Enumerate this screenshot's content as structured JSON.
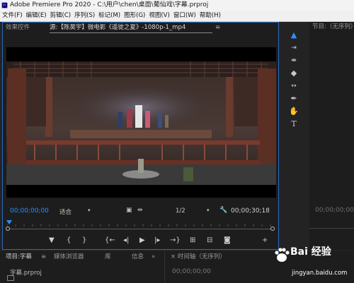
{
  "window": {
    "title": "Adobe Premiere Pro 2020 - C:\\用户\\chen\\桌面\\葡仙戏\\字幕.prproj"
  },
  "menu": [
    "文件(F)",
    "编辑(E)",
    "剪辑(C)",
    "序列(S)",
    "标记(M)",
    "图形(G)",
    "视图(V)",
    "窗口(W)",
    "帮助(H)"
  ],
  "source_panel": {
    "tab_effects": "效果控件",
    "tab_source": "源:【陈昊宇】微电影《遥徙之夏》-1080p-1_mp4",
    "tab_menu": "≡",
    "timecode_left": "00;00;00;00",
    "fit_label": "适合",
    "resolution_label": "1/2",
    "timecode_right": "00;00;30;18"
  },
  "tools": [
    "selection",
    "track-select",
    "ripple-edit",
    "razor",
    "slip",
    "pen",
    "hand",
    "type"
  ],
  "program_panel": {
    "title": "节目:（无序列）",
    "timecode": "00;00;00;00"
  },
  "bottom": {
    "tab_project": "项目:字幕",
    "tab_menu": "≡",
    "tab_media": "媒体浏览器",
    "tab_library": "库",
    "tab_info": "信息",
    "tab_more": "»",
    "project_file": "字幕.prproj",
    "timeline_title": "时间轴（无序列）",
    "timeline_tc": "00;00;00;00"
  },
  "watermark": {
    "logo": "Bai 经验",
    "url": "jingyan.baidu.com"
  },
  "colors": {
    "accent": "#2f8fff",
    "panel_bg": "#1d1d1d",
    "frame_blue": "#2a6bc0"
  }
}
